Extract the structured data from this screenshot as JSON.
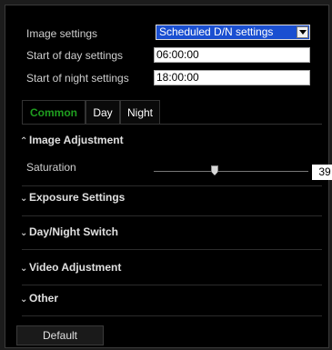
{
  "settings": {
    "image_settings_label": "Image settings",
    "image_settings_value": "Scheduled D/N settings",
    "start_day_label": "Start of day settings",
    "start_day_value": "06:00:00",
    "start_night_label": "Start of night settings",
    "start_night_value": "18:00:00"
  },
  "tabs": [
    {
      "label": "Common",
      "active": true
    },
    {
      "label": "Day",
      "active": false
    },
    {
      "label": "Night",
      "active": false
    }
  ],
  "image_adjustment": {
    "title": "Image Adjustment",
    "expanded": true,
    "saturation_label": "Saturation",
    "saturation_value": "39",
    "saturation_fraction": 0.39
  },
  "sections": [
    {
      "title": "Exposure Settings",
      "expanded": false
    },
    {
      "title": "Day/Night Switch",
      "expanded": false
    },
    {
      "title": "Video Adjustment",
      "expanded": false
    },
    {
      "title": "Other",
      "expanded": false
    }
  ],
  "default_button_label": "Default",
  "colors": {
    "active_tab": "#1f9e1f",
    "select_bg": "#1a4fd1",
    "panel_bg": "#000000"
  },
  "icons": {
    "expanded": "chevron-up-icon",
    "collapsed": "chevron-down-icon",
    "dropdown": "dropdown-arrow-icon",
    "slider": "slider-thumb-icon"
  }
}
